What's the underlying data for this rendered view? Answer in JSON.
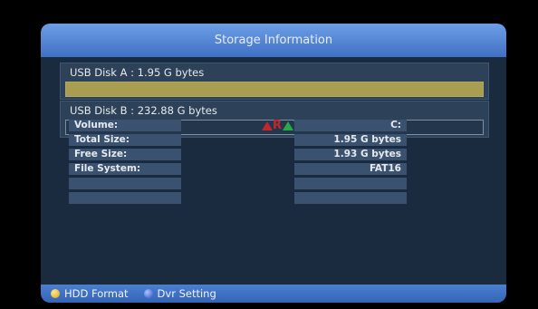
{
  "title": "Storage Information",
  "disks": [
    {
      "label": "USB Disk A : 1.95 G bytes",
      "usage_fraction": 1.0,
      "fill_color": "#a89d51"
    },
    {
      "label": "USB Disk B : 232.88 G bytes",
      "usage_fraction": 0.0,
      "fill_color": "#a89d51"
    }
  ],
  "watermark": {
    "letter1": "R",
    "letter2": "T"
  },
  "info": {
    "labels": [
      "Volume:",
      "Total Size:",
      "Free Size:",
      "File System:",
      "",
      ""
    ],
    "values": [
      "C:",
      "1.95 G bytes",
      "1.93 G bytes",
      "FAT16",
      "",
      ""
    ]
  },
  "footer": {
    "hdd_format": "HDD Format",
    "dvr_setting": "Dvr Setting"
  },
  "colors": {
    "title_bar": "#4f83d6",
    "panel": "#1b2b3f",
    "yellow_button": "#f0c020",
    "blue_button": "#3a62d8"
  }
}
